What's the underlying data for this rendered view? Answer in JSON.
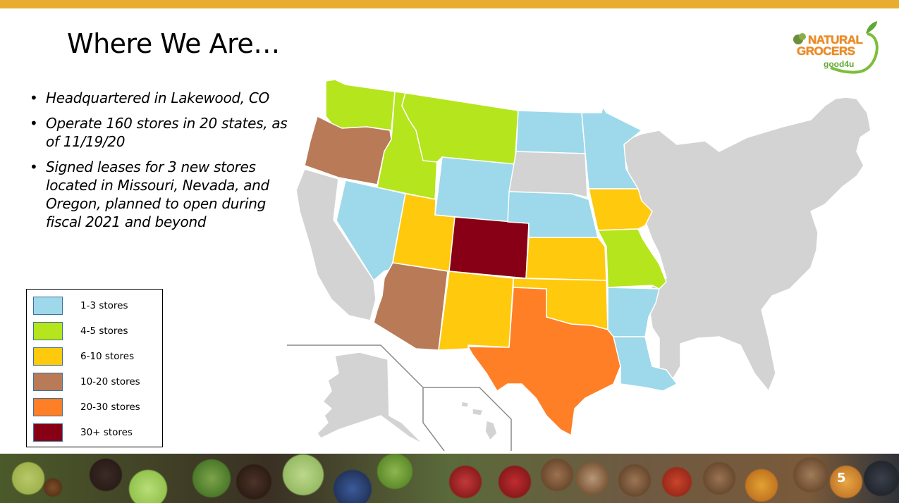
{
  "slide": {
    "title": "Where We Are…",
    "page_number": "5",
    "accent_color": "#E8AD30"
  },
  "logo": {
    "line1": "NATURAL",
    "line2": "GROCERS",
    "tagline": "good4u",
    "brand_orange": "#F08A1C",
    "brand_green": "#5FA832"
  },
  "bullets": [
    {
      "text": "Headquartered in Lakewood, CO"
    },
    {
      "text": "Operate 160 stores in 20 states, as of 11/19/20"
    },
    {
      "text": "Signed leases for 3 new stores located in Missouri, Nevada, and Oregon, planned to open during fiscal 2021 and beyond"
    }
  ],
  "legend": {
    "items": [
      {
        "label": "1-3 stores",
        "color": "#9DD9EA"
      },
      {
        "label": "4-5 stores",
        "color": "#B5E51D"
      },
      {
        "label": "6-10 stores",
        "color": "#FFC90E"
      },
      {
        "label": "10-20 stores",
        "color": "#B97A57"
      },
      {
        "label": "20-30 stores",
        "color": "#FF7F27"
      },
      {
        "label": "30+ stores",
        "color": "#880015"
      }
    ]
  },
  "map": {
    "no_stores_color": "#D3D3D3",
    "state_categories": {
      "WA": "4-5 stores",
      "ID": "4-5 stores",
      "MT": "4-5 stores",
      "MO": "4-5 stores",
      "OR": "10-20 stores",
      "AZ": "10-20 stores",
      "NV": "1-3 stores",
      "WY": "1-3 stores",
      "ND": "1-3 stores",
      "MN": "1-3 stores",
      "NE": "1-3 stores",
      "AR": "1-3 stores",
      "LA": "1-3 stores",
      "UT": "6-10 stores",
      "NM": "6-10 stores",
      "KS": "6-10 stores",
      "OK": "6-10 stores",
      "IA": "6-10 stores",
      "CO": "30+ stores",
      "TX": "20-30 stores"
    }
  }
}
